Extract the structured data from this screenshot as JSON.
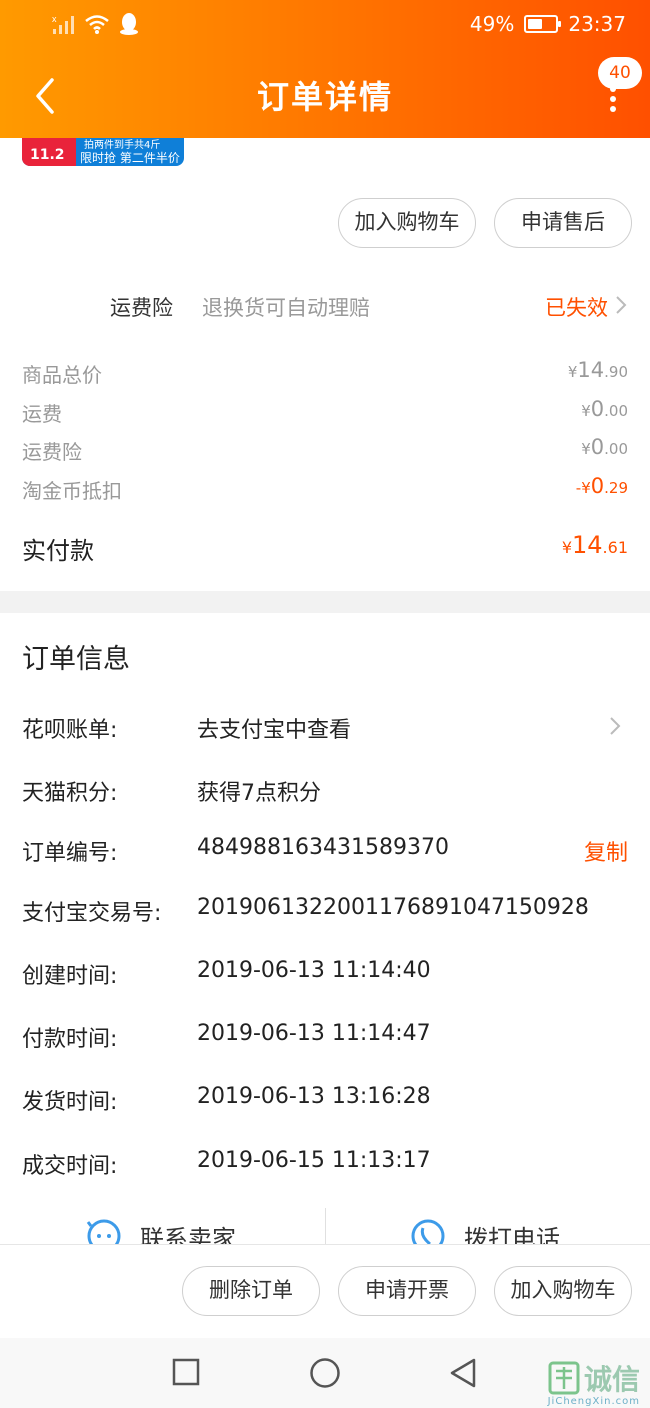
{
  "status_bar": {
    "battery_percent": "49%",
    "battery_level": 0.49,
    "time": "23:37"
  },
  "header": {
    "title": "订单详情",
    "badge_count": "40"
  },
  "promo": {
    "price": "11.2",
    "top_line": "拍两件到手共4斤",
    "text": "限时抢 第二件半价"
  },
  "item_actions": {
    "add_cart": "加入购物车",
    "after_sale": "申请售后"
  },
  "insurance": {
    "label": "运费险",
    "desc": "退换货可自动理赔",
    "status": "已失效"
  },
  "price_rows": [
    {
      "label": "商品总价",
      "prefix": "¥",
      "int": "14",
      "dec": ".90"
    },
    {
      "label": "运费",
      "prefix": "¥",
      "int": "0",
      "dec": ".00"
    },
    {
      "label": "运费险",
      "prefix": "¥",
      "int": "0",
      "dec": ".00"
    },
    {
      "label": "淘金币抵扣",
      "prefix": "-¥",
      "int": "0",
      "dec": ".29"
    }
  ],
  "paid": {
    "label": "实付款",
    "prefix": "¥",
    "int": "14",
    "dec": ".61"
  },
  "order_info": {
    "title": "订单信息",
    "rows": [
      {
        "label": "花呗账单:",
        "value": "去支付宝中查看"
      },
      {
        "label": "天猫积分:",
        "value": "获得7点积分"
      },
      {
        "label": "订单编号:",
        "value": "484988163431589370",
        "action": "复制"
      },
      {
        "label": "支付宝交易号:",
        "value": "2019061322001176891047150928"
      },
      {
        "label": "创建时间:",
        "value": "2019-06-13 11:14:40"
      },
      {
        "label": "付款时间:",
        "value": "2019-06-13 11:14:47"
      },
      {
        "label": "发货时间:",
        "value": "2019-06-13 13:16:28"
      },
      {
        "label": "成交时间:",
        "value": "2019-06-15 11:13:17"
      }
    ]
  },
  "contact": {
    "seller": "联系卖家",
    "phone": "拨打电话"
  },
  "bottom_actions": {
    "delete": "删除订单",
    "invoice": "申请开票",
    "add_cart": "加入购物车"
  },
  "colors": {
    "accent": "#ff5000",
    "header_start": "#ff9a00",
    "contact_icon": "#3d9be9"
  },
  "icons": [
    "back-icon",
    "more-icon",
    "chevron-right-icon",
    "chat-icon",
    "phone-icon",
    "wifi-icon",
    "signal-icon",
    "qq-icon",
    "battery-icon"
  ],
  "watermark": {
    "text": "诚信",
    "sub": "JiChengXin.com"
  }
}
